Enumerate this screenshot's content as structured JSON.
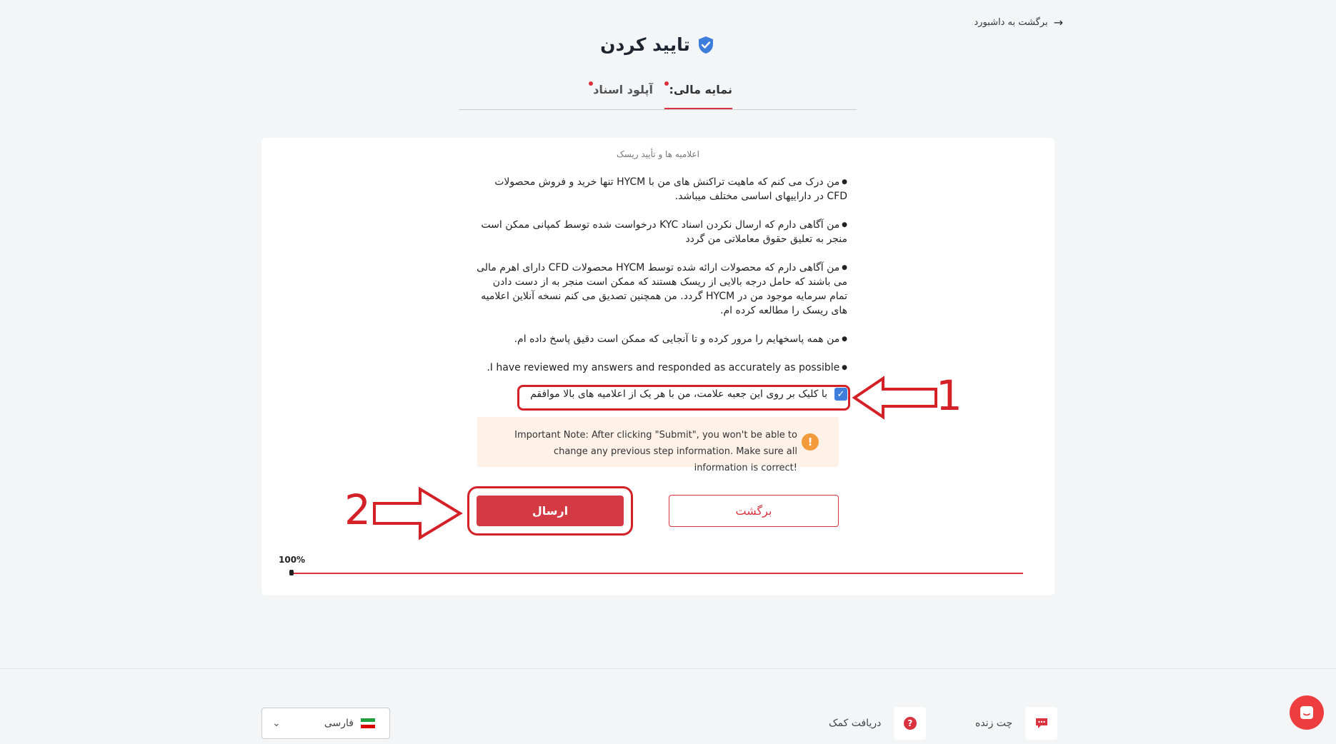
{
  "header": {
    "back_link": "برگشت به داشبورد",
    "title": "تایید کردن"
  },
  "tabs": [
    {
      "label": "نمایه مالی:",
      "active": true
    },
    {
      "label": "آپلود اسناد",
      "active": false
    }
  ],
  "card": {
    "caption": "اعلامیه ها و تأیید ریسک",
    "disclosures": [
      "من درک می کنم که ماهیت تراکنش های من با HYCM تنها خرید و فروش محصولات CFD در داراییهای اساسی مختلف میباشد.",
      "من آگاهی دارم که ارسال نکردن اسناد KYC درخواست شده توسط کمپانی ممکن است منجر به تعلیق حقوق معاملاتی من گردد",
      "من آگاهی دارم که محصولات ارائه شده توسط HYCM محصولات CFD دارای اهرم مالی می باشند که حامل درجه بالایی از ریسک هستند که ممکن است منجر به از دست دادن تمام سرمایه موجود من در HYCM گردد. من همچنین تصدیق می کنم نسخه آنلاین اعلامیه های ریسک را مطالعه کرده ام.",
      "من همه پاسخهایم را مرور کرده و تا آنجایی که ممکن است دقیق پاسخ داده ام.",
      "I have reviewed my answers and responded as accurately as possible."
    ],
    "agree_label": "با کلیک بر روی این جعبه علامت، من با هر یک از اعلامیه های بالا موافقم",
    "agree_checked": true,
    "note": "Important Note: After clicking \"Submit\", you won't be able to change any previous step information. Make sure all information is correct!",
    "buttons": {
      "back": "برگشت",
      "submit": "ارسال"
    },
    "progress": {
      "label": "100%",
      "value": 1.0
    }
  },
  "annotations": {
    "step_one": "1",
    "step_two": "2",
    "color": "#d42027"
  },
  "footer": {
    "language": "فارسی",
    "get_help": "دریافت کمک",
    "live_chat": "چت زنده"
  },
  "colors": {
    "accent": "#d8333f",
    "checkbox": "#3d7ddb",
    "note_bg": "#fdf1e8"
  }
}
